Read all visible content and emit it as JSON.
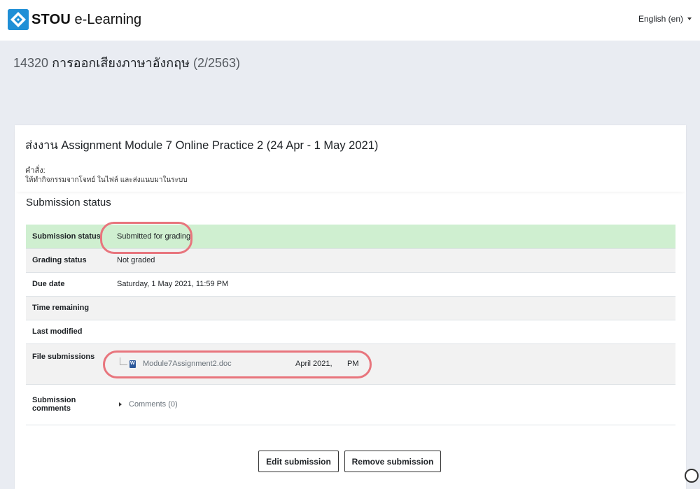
{
  "navbar": {
    "brand_bold": "STOU",
    "brand_rest": " e-Learning",
    "language": "English (en)"
  },
  "course": {
    "code": "14320",
    "name": "การออกเสียงภาษาอังกฤษ",
    "term": "(2/2563)"
  },
  "assignment": {
    "title": "ส่งงาน Assignment Module 7 Online Practice 2 (24 Apr - 1 May 2021)",
    "instructions_label": "คำสั่ง:",
    "instructions_text": "ให้ทำกิจกรรมจากโจทย์ ในไฟล์ และส่งแนบมาในระบบ"
  },
  "submission": {
    "section_title": "Submission status",
    "rows": {
      "status_label": "Submission status",
      "status_value": "Submitted for grading",
      "grading_label": "Grading status",
      "grading_value": "Not graded",
      "due_label": "Due date",
      "due_value": "Saturday, 1 May 2021, 11:59 PM",
      "time_label": "Time remaining",
      "time_value": "",
      "modified_label": "Last modified",
      "modified_value": "",
      "files_label": "File submissions",
      "file_name": "Module7Assignment2.doc",
      "file_date": "April 2021,",
      "file_time": "PM",
      "comments_label": "Submission comments",
      "comments_link": "Comments (0)"
    }
  },
  "actions": {
    "edit": "Edit submission",
    "remove": "Remove submission"
  },
  "colors": {
    "success_row": "#cfefd0",
    "highlight_oval": "#e8757d",
    "page_bg": "#e9ecf2",
    "brand_blue": "#1f8fd6"
  },
  "icons": [
    "stou-logo-icon",
    "caret-down-icon",
    "word-doc-icon",
    "expand-triangle-icon"
  ]
}
